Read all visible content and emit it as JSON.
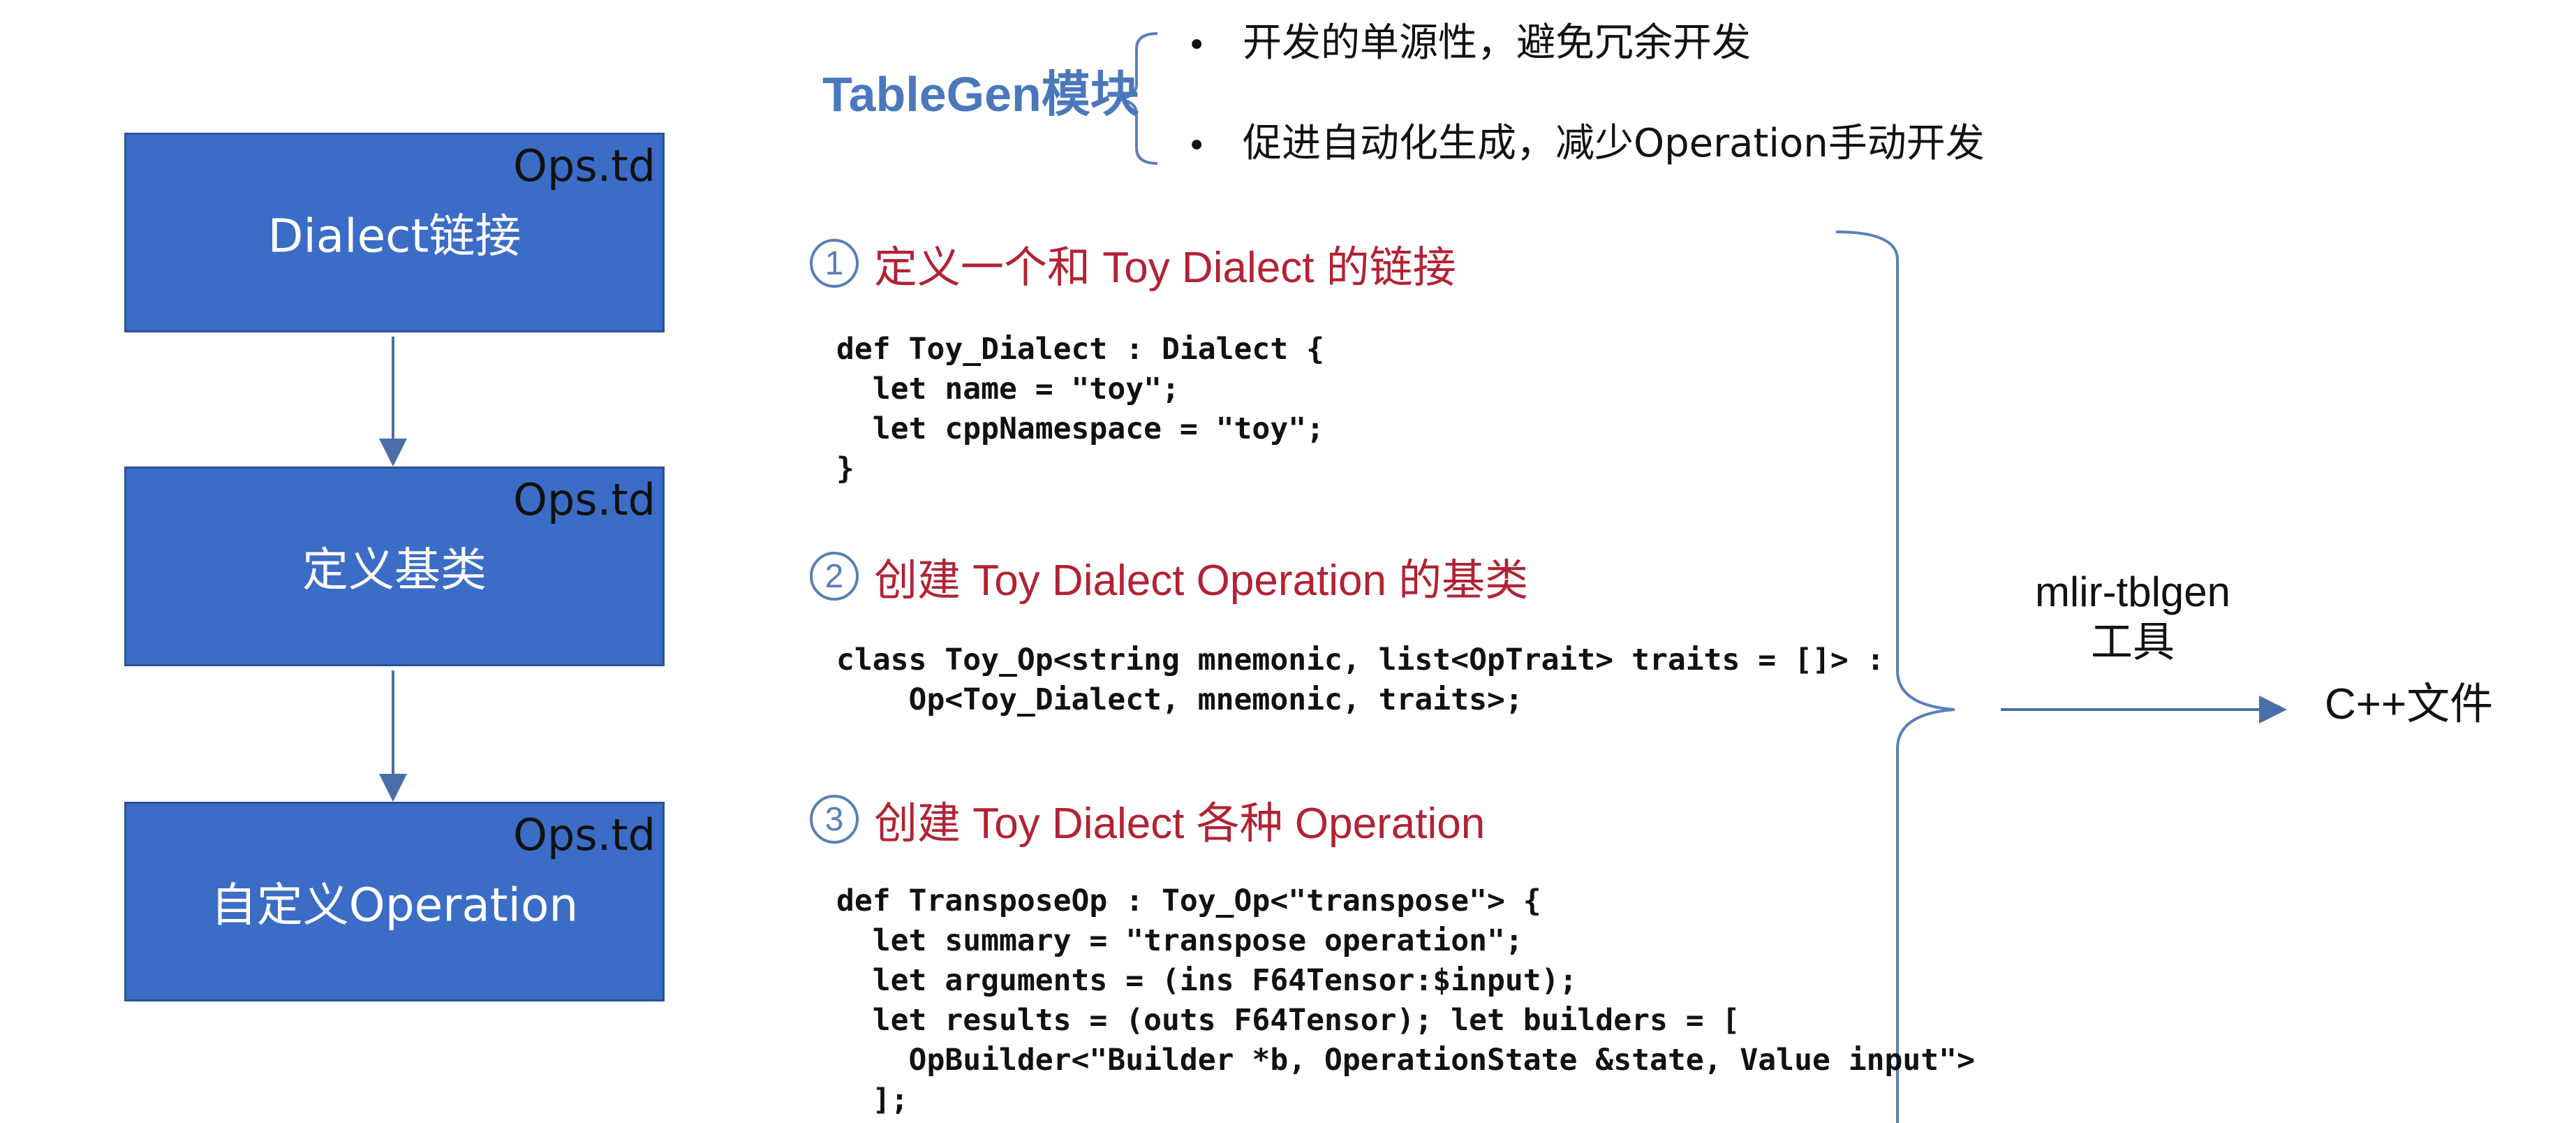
{
  "flow": {
    "boxes": [
      {
        "file": "Ops.td",
        "label": "Dialect链接"
      },
      {
        "file": "Ops.td",
        "label": "定义基类"
      },
      {
        "file": "Ops.td",
        "label": "自定义Operation"
      }
    ]
  },
  "tablegen": {
    "title": "TableGen模块",
    "bullets": [
      "开发的单源性，避免冗余开发",
      "促进自动化生成，减少Operation手动开发"
    ],
    "bullet_symbol": "•"
  },
  "sections": [
    {
      "number": "1",
      "title": "定义一个和 Toy Dialect 的链接",
      "code": "def Toy_Dialect : Dialect {\n  let name = \"toy\";\n  let cppNamespace = \"toy\";\n}"
    },
    {
      "number": "2",
      "title": "创建 Toy Dialect Operation 的基类",
      "code": "class Toy_Op<string mnemonic, list<OpTrait> traits = []> :\n    Op<Toy_Dialect, mnemonic, traits>;"
    },
    {
      "number": "3",
      "title": "创建 Toy Dialect 各种 Operation",
      "code": "def TransposeOp : Toy_Op<\"transpose\"> {\n  let summary = \"transpose operation\";\n  let arguments = (ins F64Tensor:$input);\n  let results = (outs F64Tensor); let builders = [\n    OpBuilder<\"Builder *b, OperationState &state, Value input\">\n  ];"
    }
  ],
  "tool": {
    "line1": "mlir-tblgen",
    "line2": "工具"
  },
  "output": "C++文件",
  "colors": {
    "box_fill": "#3b6cc6",
    "section_title": "#b22234",
    "module_title": "#4b78bd",
    "connector": "#4a6fa8"
  }
}
